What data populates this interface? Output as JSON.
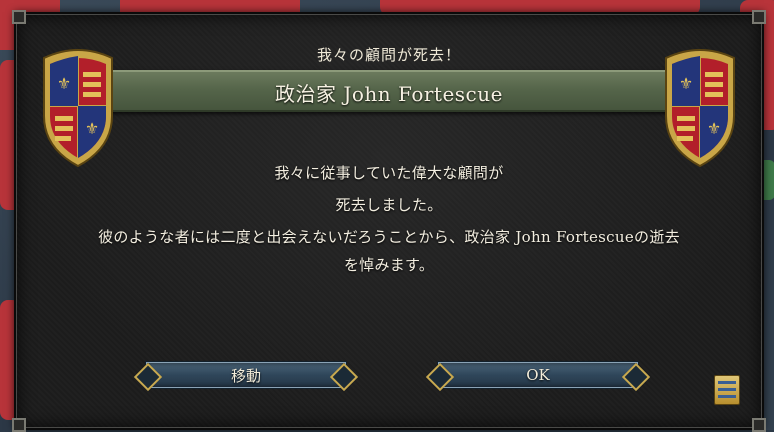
{
  "dialog": {
    "title": "我々の顧問が死去！",
    "banner": "政治家 John Fortescue",
    "body_line1": "我々に従事していた偉大な顧問が",
    "body_line2": "死去しました。",
    "body_line3": "彼のような者には二度と出会えないだろうことから、政治家 John Fortescueの逝去",
    "body_line4": "を悼みます。"
  },
  "buttons": {
    "move_label": "移動",
    "ok_label": "OK"
  },
  "icons": {
    "left_shield": "coat-of-arms-icon",
    "right_shield": "coat-of-arms-icon",
    "ledger": "ledger-icon"
  },
  "colors": {
    "banner_green": "#55654a",
    "button_blue": "#2f465a",
    "gold_trim": "#c8a94f",
    "text_cream": "#f3eee0"
  }
}
